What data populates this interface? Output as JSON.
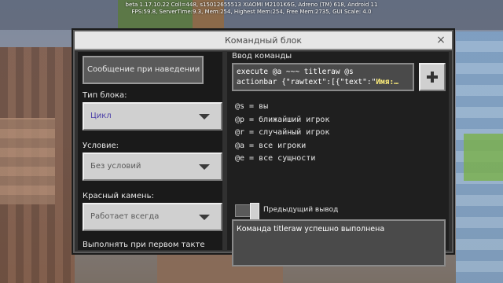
{
  "debug": {
    "line1": "beta 1.17.10.22 Coll=448, s15012655513 XIAOMI M2101K6G, Adreno (TM) 618, Android 11",
    "line2": "FPS:59.8, ServerTime:9.3, Mem:254, Highest Mem:254, Free Mem:2735, GUI Scale: 4.0"
  },
  "dialog": {
    "title": "Командный блок",
    "close_icon": "×"
  },
  "left_panel": {
    "hover_placeholder": "Сообщение при наведении",
    "block_type_label": "Тип блока:",
    "block_type_value": "Цикл",
    "condition_label": "Условие:",
    "condition_value": "Без условий",
    "redstone_label": "Красный камень:",
    "redstone_value": "Работает всегда",
    "first_tick_label": "Выполнять при первом такте"
  },
  "right_panel": {
    "input_title": "Ввод команды",
    "command_line1": "execute @a ~~~ titleraw @s",
    "command_line2": "actionbar {\"rawtext\":[{\"text\":\"",
    "command_highlight": "Имя:…",
    "add_icon": "plus-icon",
    "selectors": [
      "@s = вы",
      "@p = ближайший игрок",
      "@r = случайный игрок",
      "@a = все игроки",
      "@e = все сущности"
    ],
    "previous_output_label": "Предыдущий вывод",
    "output_text": "Команда titleraw успешно выполнена"
  },
  "colors": {
    "dialog_bg": "#313131",
    "highlight": "#ffef7a",
    "block_type_value": "#4b3fa8"
  }
}
